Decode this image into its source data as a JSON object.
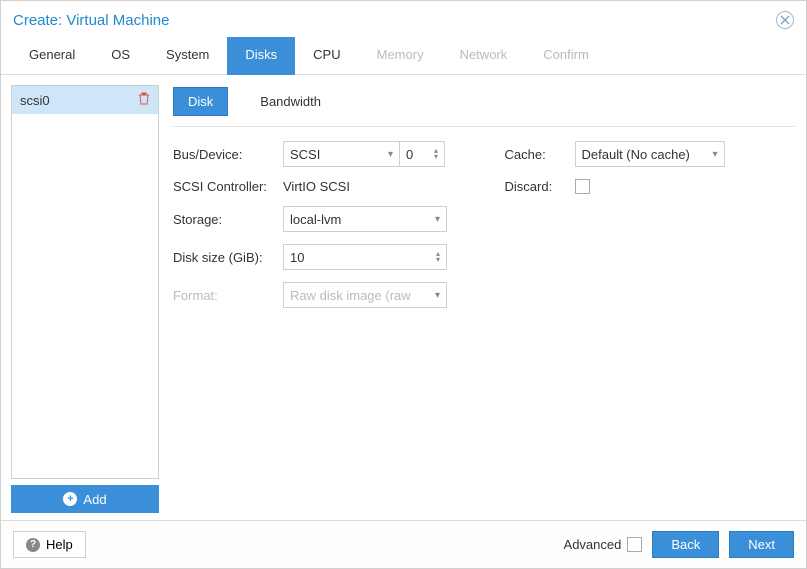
{
  "title": "Create: Virtual Machine",
  "tabs": {
    "general": "General",
    "os": "OS",
    "system": "System",
    "disks": "Disks",
    "cpu": "CPU",
    "memory": "Memory",
    "network": "Network",
    "confirm": "Confirm"
  },
  "disk_list": {
    "items": [
      {
        "name": "scsi0"
      }
    ],
    "add_label": "Add"
  },
  "subtabs": {
    "disk": "Disk",
    "bandwidth": "Bandwidth"
  },
  "form": {
    "bus_device_label": "Bus/Device:",
    "bus_value": "SCSI",
    "device_value": "0",
    "scsi_controller_label": "SCSI Controller:",
    "scsi_controller_value": "VirtIO SCSI",
    "storage_label": "Storage:",
    "storage_value": "local-lvm",
    "disk_size_label": "Disk size (GiB):",
    "disk_size_value": "10",
    "format_label": "Format:",
    "format_value": "Raw disk image (raw",
    "cache_label": "Cache:",
    "cache_value": "Default (No cache)",
    "discard_label": "Discard:"
  },
  "footer": {
    "help": "Help",
    "advanced": "Advanced",
    "back": "Back",
    "next": "Next"
  }
}
